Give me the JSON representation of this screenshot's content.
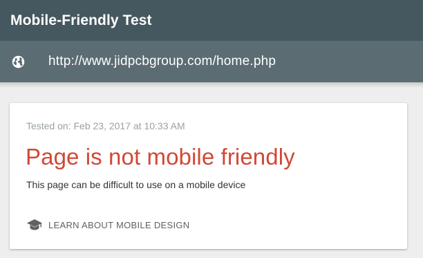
{
  "header": {
    "title": "Mobile-Friendly Test"
  },
  "urlbar": {
    "icon": "globe-icon",
    "url": "http://www.jidpcbgroup.com/home.php"
  },
  "result": {
    "tested_on": "Tested on: Feb 23, 2017 at 10:33 AM",
    "verdict": "Page is not mobile friendly",
    "description": "This page can be difficult to use on a mobile device",
    "learn_icon": "graduation-cap-icon",
    "learn_label": "LEARN ABOUT MOBILE DESIGN"
  },
  "colors": {
    "header_bg": "#46585f",
    "urlbar_bg": "#5c6c73",
    "verdict": "#d14836"
  }
}
